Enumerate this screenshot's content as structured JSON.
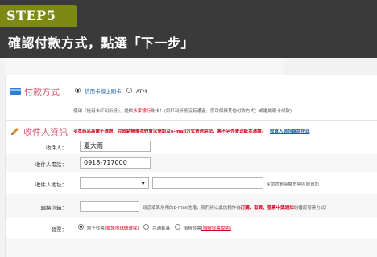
{
  "header": {
    "step": "STEP5",
    "title": "確認付款方式，點選「下一步」"
  },
  "payment": {
    "section_title": "付款方式",
    "options": [
      {
        "label": "信用卡線上刷卡",
        "selected": true
      },
      {
        "label": "ATM",
        "selected": false
      }
    ],
    "note_prefix": "使用『信用卡紅利折抵』，提供",
    "note_bank": "多家銀行",
    "note_suffix": "刷卡！(如紅利折抵沒有通過，您可個擇其他付款方式；或繼續刷卡付款)"
  },
  "recipient": {
    "section_title": "收件人資訊",
    "notice": "※本商品為電子憑證，完成結帳後我們會以簡訊及e-mail方式寄送給您，將不另外寄送紙本憑證。",
    "notice_link": "收貨人通訊錄請按此",
    "fields": {
      "name_label": "收件人：",
      "name_value": "夏大雨",
      "phone_label": "收件人電話：",
      "phone_value": "0918-717000",
      "address_label": "收件人地址：",
      "address_hint": "※請勿刪除縣市與區域資訊",
      "email_label": "聯絡信箱：",
      "email_note_prefix": "請您填寫常用的E-mail信箱，我們將以此信箱作為",
      "email_note_highlight": "訂購、取貨、發票中獎通知",
      "email_note_suffix": "的確認發票方式！",
      "invoice_label": "發票：",
      "invoice_options": [
        {
          "label": "電子發票",
          "sub": "(愛護地球做環保)",
          "selected": true
        },
        {
          "label": "共通載具",
          "sub": "",
          "selected": false
        },
        {
          "label": "捐贈發票",
          "sub": "(捐贈發票說明)",
          "selected": false
        }
      ]
    }
  },
  "colors": {
    "header_bg": "#3a3a3a",
    "step_badge": "#7c8a13",
    "section_title": "#d25c76",
    "accent_red": "#d0021b",
    "link_blue": "#1f5fb5"
  }
}
